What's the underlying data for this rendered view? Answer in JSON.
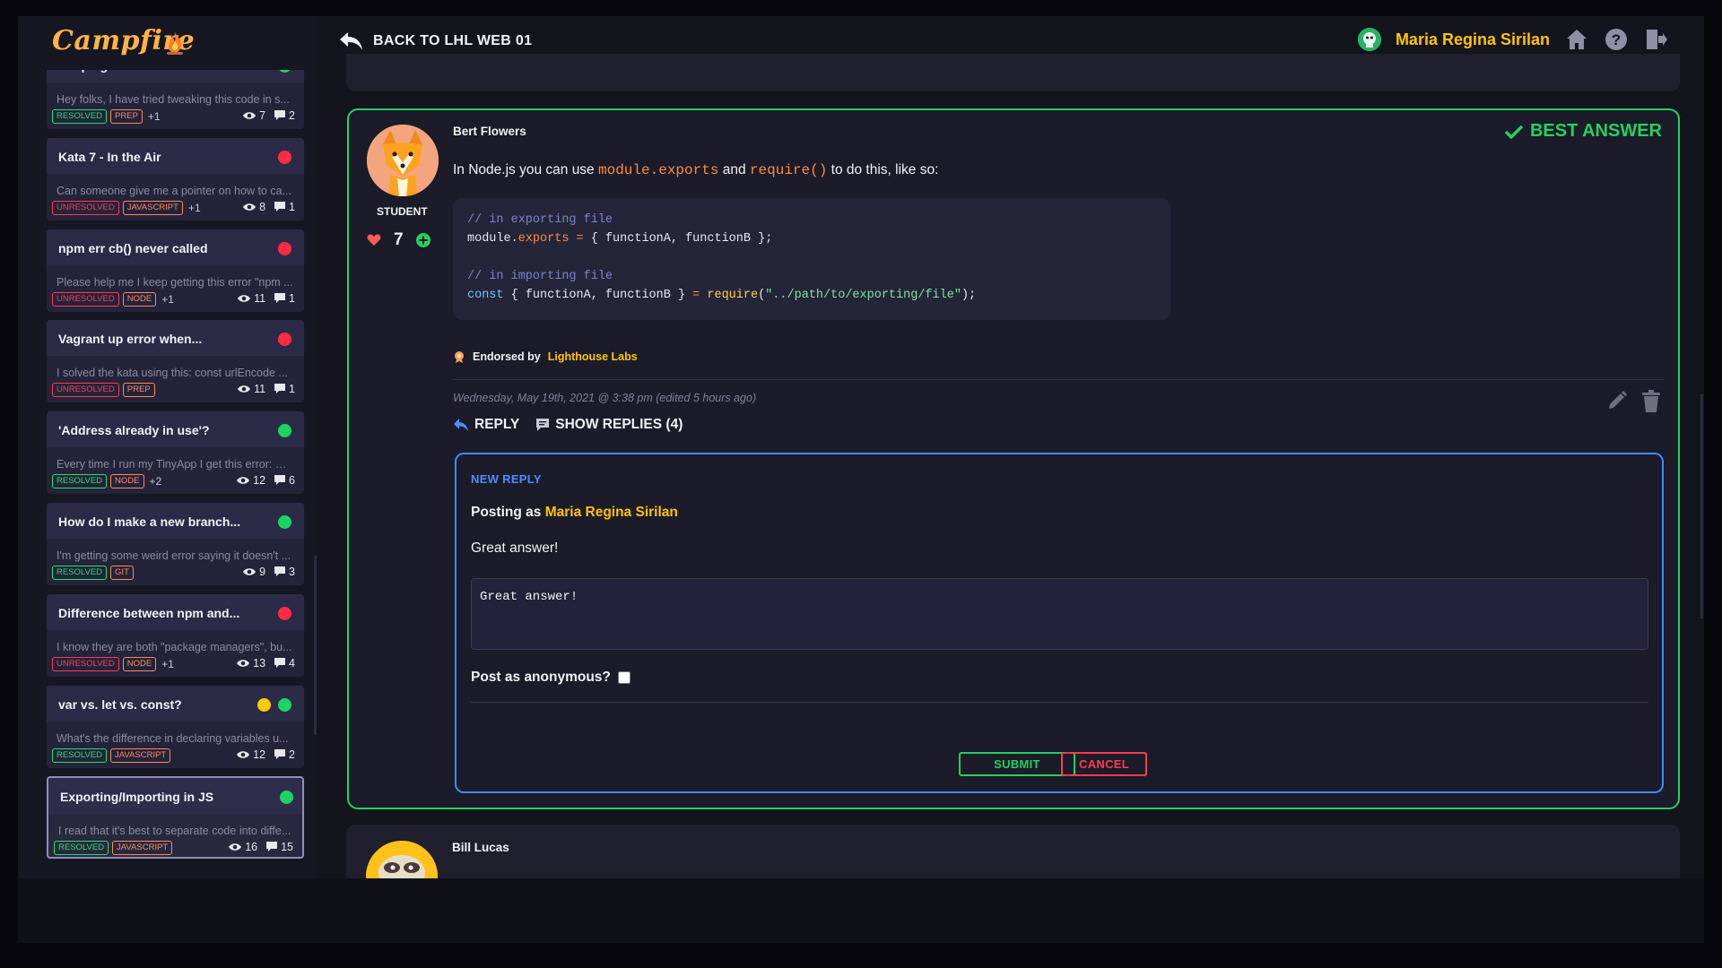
{
  "app": {
    "brand": "Campfire"
  },
  "header": {
    "back_label": "BACK TO LHL WEB 01",
    "user_name": "Maria Regina Sirilan"
  },
  "sidebar": {
    "cards": [
      {
        "title": "Looping",
        "excerpt": "Hey folks, I have tried tweaking this code in s...",
        "status": "RESOLVED",
        "tags": [
          "PREP"
        ],
        "more": "+1",
        "views": "7",
        "replies": "2",
        "dots": [
          "green"
        ]
      },
      {
        "title": "Kata 7 - In the Air",
        "excerpt": "Can someone give me a pointer on how to ca...",
        "status": "UNRESOLVED",
        "tags": [
          "JAVASCRIPT"
        ],
        "more": "+1",
        "views": "8",
        "replies": "1",
        "dots": [
          "red"
        ]
      },
      {
        "title": "npm err cb() never called",
        "excerpt": "Please help me I keep getting this error \"npm ...",
        "status": "UNRESOLVED",
        "tags": [
          "NODE"
        ],
        "more": "+1",
        "views": "11",
        "replies": "1",
        "dots": [
          "red"
        ]
      },
      {
        "title": "Vagrant up error when...",
        "excerpt": "I solved the kata using this: const urlEncode ...",
        "status": "UNRESOLVED",
        "tags": [
          "PREP"
        ],
        "more": "",
        "views": "11",
        "replies": "1",
        "dots": [
          "red"
        ]
      },
      {
        "title": "'Address already in use'?",
        "excerpt": "Every time I run my TinyApp I get this error: Er...",
        "status": "RESOLVED",
        "tags": [
          "NODE"
        ],
        "more": "+2",
        "views": "12",
        "replies": "6",
        "dots": [
          "green"
        ]
      },
      {
        "title": "How do I make a new branch...",
        "excerpt": "I'm getting some weird error saying it doesn't ...",
        "status": "RESOLVED",
        "tags": [
          "GIT"
        ],
        "more": "",
        "views": "9",
        "replies": "3",
        "dots": [
          "green"
        ]
      },
      {
        "title": "Difference between npm and...",
        "excerpt": "I know they are both \"package managers\", bu...",
        "status": "UNRESOLVED",
        "tags": [
          "NODE"
        ],
        "more": "+1",
        "views": "13",
        "replies": "4",
        "dots": [
          "red"
        ]
      },
      {
        "title": "var vs. let vs. const?",
        "excerpt": "What's the difference in declaring variables u...",
        "status": "RESOLVED",
        "tags": [
          "JAVASCRIPT"
        ],
        "more": "",
        "views": "12",
        "replies": "2",
        "dots": [
          "yellow",
          "green"
        ]
      },
      {
        "title": "Exporting/Importing in JS",
        "excerpt": "I read that it's best to separate code into diffe...",
        "status": "RESOLVED",
        "tags": [
          "JAVASCRIPT"
        ],
        "more": "",
        "views": "16",
        "replies": "15",
        "dots": [
          "green"
        ],
        "active": true
      }
    ]
  },
  "answer": {
    "author": "Bert Flowers",
    "role": "STUDENT",
    "votes": "7",
    "best_label": "BEST ANSWER",
    "text_before": "In Node.js you can use ",
    "code_inline_1": "module.exports",
    "text_mid": " and ",
    "code_inline_2": "require()",
    "text_after": " to do this, like so:",
    "code": {
      "line1": "// in exporting file",
      "line3": "// in importing file"
    },
    "endorsed_prefix": "Endorsed by",
    "endorsed_by": "Lighthouse Labs",
    "date": "Wednesday, May 19th, 2021 @ 3:38 pm (edited 5 hours ago)",
    "reply_label": "REPLY",
    "show_replies_label": "SHOW REPLIES (4)"
  },
  "reply_form": {
    "title": "NEW REPLY",
    "posting_as_prefix": "Posting as",
    "posting_as_name": "Maria Regina Sirilan",
    "preview": "Great answer!",
    "textarea_value": "Great answer!",
    "anonymous_label": "Post as anonymous?",
    "submit_label": "SUBMIT",
    "cancel_label": "CANCEL"
  },
  "next_post": {
    "author": "Bill Lucas"
  },
  "colors": {
    "accent_green": "#23d160",
    "accent_yellow": "#ffc400",
    "accent_blue": "#3d8bff",
    "danger": "#ff3b52",
    "brand_orange": "#ffb347"
  }
}
